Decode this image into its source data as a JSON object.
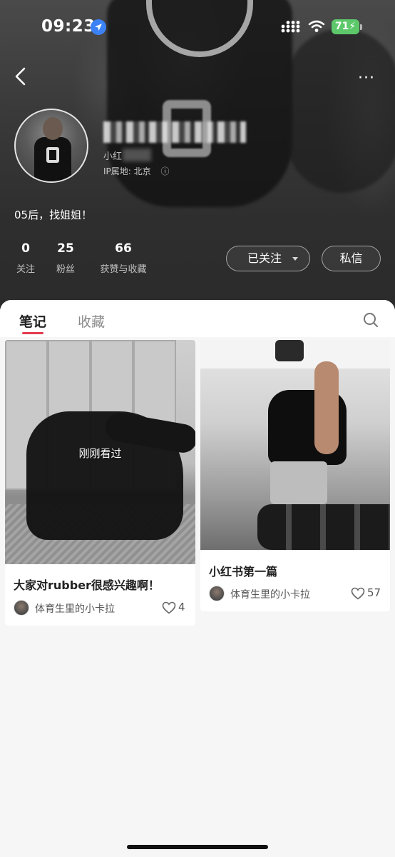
{
  "status_bar": {
    "time": "09:23",
    "battery": "71"
  },
  "profile": {
    "id_prefix": "小红",
    "ip_location": "IP属地: 北京",
    "bio": "05后，找姐姐！",
    "stats": [
      {
        "value": "0",
        "label": "关注"
      },
      {
        "value": "25",
        "label": "粉丝"
      },
      {
        "value": "66",
        "label": "获赞与收藏"
      }
    ],
    "follow_button": "已关注",
    "message_button": "私信"
  },
  "tabs": [
    {
      "label": "笔记",
      "active": true
    },
    {
      "label": "收藏",
      "active": false
    }
  ],
  "notes": [
    {
      "title": "大家对rubber很感兴趣啊！",
      "overlay": "刚刚看过",
      "author": "体育生里的小卡拉",
      "likes": "4"
    },
    {
      "title": "小红书第一篇",
      "author": "体育生里的小卡拉",
      "likes": "57"
    }
  ],
  "colors": {
    "accent": "#e33b4e",
    "header_bg": "#2e2e2e",
    "battery": "#5cc86a",
    "location": "#3b82f6"
  },
  "icons": {
    "back": "chevron-left-icon",
    "more": "more-icon",
    "search": "search-icon",
    "like": "heart-icon",
    "dropdown": "caret-down-icon",
    "info": "info-icon"
  }
}
